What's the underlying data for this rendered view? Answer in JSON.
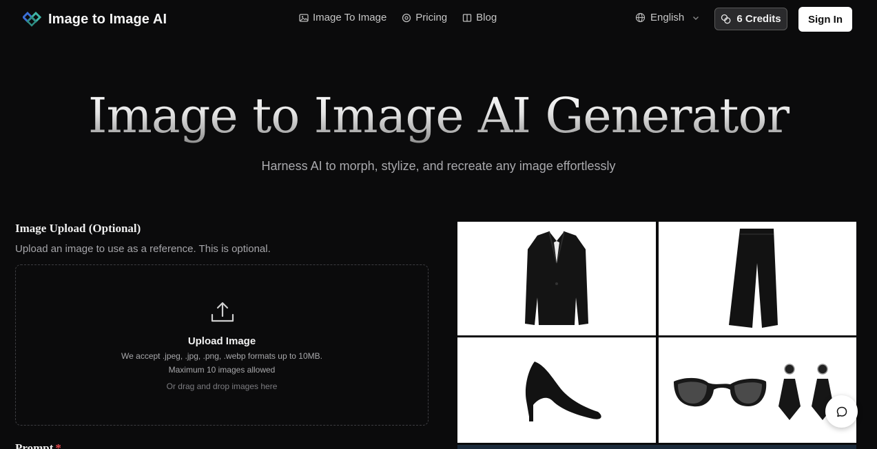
{
  "header": {
    "brand_name": "Image to Image AI",
    "brand_logo_icon": "diamond-logo-icon",
    "nav": [
      {
        "label": "Image To Image",
        "icon": "image-icon"
      },
      {
        "label": "Pricing",
        "icon": "coin-icon"
      },
      {
        "label": "Blog",
        "icon": "book-icon"
      }
    ],
    "language": {
      "label": "English",
      "icon": "globe-icon"
    },
    "credits_label": "6 Credits",
    "credits_icon": "coins-icon",
    "signin_label": "Sign In"
  },
  "hero": {
    "title": "Image to Image AI Generator",
    "subtitle": "Harness AI to morph, stylize, and recreate any image effortlessly"
  },
  "upload": {
    "section_title": "Image Upload (Optional)",
    "section_desc": "Upload an image to use as a reference. This is optional.",
    "title": "Upload Image",
    "formats": "We accept .jpeg, .jpg, .png, .webp formats up to 10MB.",
    "max": "Maximum 10 images allowed",
    "drag_hint": "Or drag and drop images here"
  },
  "prompt": {
    "label": "Prompt",
    "required_mark": "*"
  },
  "gallery": {
    "tiles": [
      "black blazer",
      "black trousers",
      "black high heel",
      "sunglasses and earrings"
    ]
  },
  "colors": {
    "background": "#0b0b0c",
    "accent_logo_teal": "#3fb6a8",
    "accent_logo_blue": "#3b6fd6",
    "required": "#e5484d"
  }
}
